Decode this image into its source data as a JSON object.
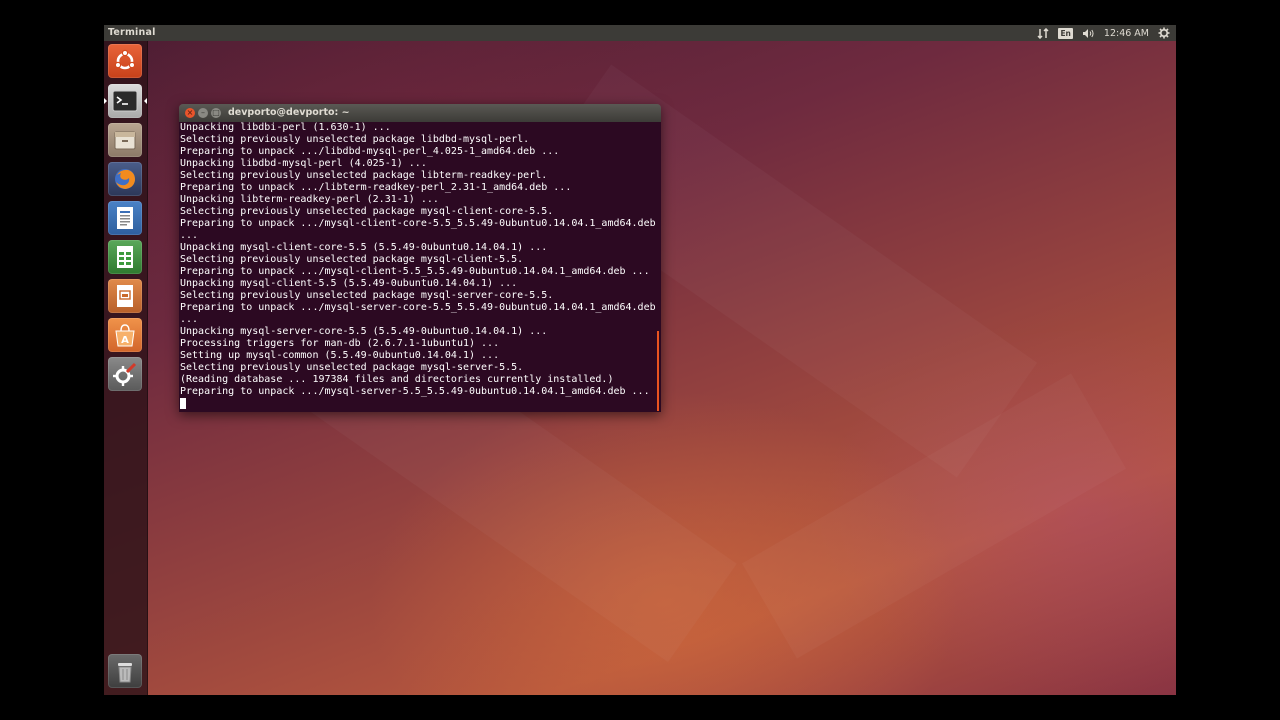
{
  "topbar": {
    "app_title": "Terminal",
    "keyboard_layout": "En",
    "clock": "12:46 AM",
    "icons": [
      "network-icon",
      "keyboard-layout-indicator",
      "volume-icon",
      "gear-icon"
    ]
  },
  "launcher": {
    "items": [
      {
        "name": "ubuntu-dash",
        "icon": "ubuntu-logo-icon"
      },
      {
        "name": "terminal",
        "icon": "terminal-icon",
        "active": true
      },
      {
        "name": "files",
        "icon": "files-icon"
      },
      {
        "name": "firefox",
        "icon": "firefox-icon"
      },
      {
        "name": "libreoffice-writer",
        "icon": "writer-icon"
      },
      {
        "name": "libreoffice-calc",
        "icon": "calc-icon"
      },
      {
        "name": "libreoffice-impress",
        "icon": "impress-icon"
      },
      {
        "name": "ubuntu-software-center",
        "icon": "software-center-icon"
      },
      {
        "name": "system-settings",
        "icon": "settings-icon"
      },
      {
        "name": "trash",
        "icon": "trash-icon"
      }
    ]
  },
  "window": {
    "title": "devporto@devporto: ~",
    "terminal_lines": [
      "Unpacking libdbi-perl (1.630-1) ...",
      "Selecting previously unselected package libdbd-mysql-perl.",
      "Preparing to unpack .../libdbd-mysql-perl_4.025-1_amd64.deb ...",
      "Unpacking libdbd-mysql-perl (4.025-1) ...",
      "Selecting previously unselected package libterm-readkey-perl.",
      "Preparing to unpack .../libterm-readkey-perl_2.31-1_amd64.deb ...",
      "Unpacking libterm-readkey-perl (2.31-1) ...",
      "Selecting previously unselected package mysql-client-core-5.5.",
      "Preparing to unpack .../mysql-client-core-5.5_5.5.49-0ubuntu0.14.04.1_amd64.deb",
      "...",
      "Unpacking mysql-client-core-5.5 (5.5.49-0ubuntu0.14.04.1) ...",
      "Selecting previously unselected package mysql-client-5.5.",
      "Preparing to unpack .../mysql-client-5.5_5.5.49-0ubuntu0.14.04.1_amd64.deb ...",
      "Unpacking mysql-client-5.5 (5.5.49-0ubuntu0.14.04.1) ...",
      "Selecting previously unselected package mysql-server-core-5.5.",
      "Preparing to unpack .../mysql-server-core-5.5_5.5.49-0ubuntu0.14.04.1_amd64.deb",
      "...",
      "Unpacking mysql-server-core-5.5 (5.5.49-0ubuntu0.14.04.1) ...",
      "Processing triggers for man-db (2.6.7.1-1ubuntu1) ...",
      "Setting up mysql-common (5.5.49-0ubuntu0.14.04.1) ...",
      "Selecting previously unselected package mysql-server-5.5.",
      "(Reading database ... 197384 files and directories currently installed.)",
      "Preparing to unpack .../mysql-server-5.5_5.5.49-0ubuntu0.14.04.1_amd64.deb ..."
    ]
  },
  "colors": {
    "terminal_bg": "#2c0922",
    "accent": "#e95420",
    "panel": "#3c3b37"
  }
}
